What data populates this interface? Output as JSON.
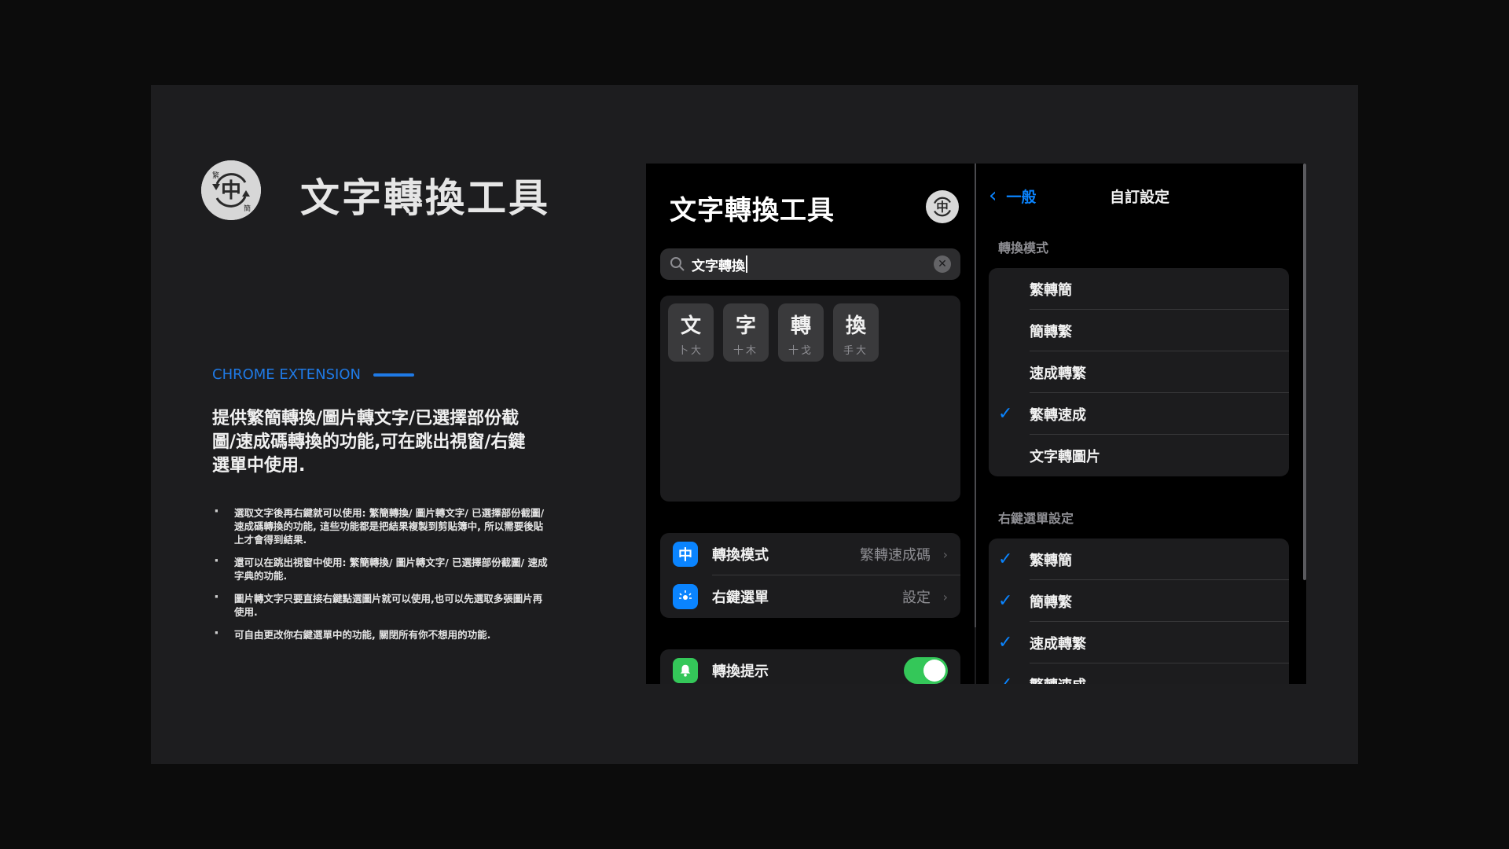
{
  "hero": {
    "title": "文字轉換工具",
    "logo_text": {
      "center": "中",
      "top": "繁",
      "bottom": "簡"
    },
    "eyebrow": "CHROME EXTENSION",
    "lead": "提供繁簡轉換/圖片轉文字/已選擇部份截圖/速成碼轉換的功能,可在跳出視窗/右鍵選單中使用.",
    "bullets": [
      "選取文字後再右鍵就可以使用: 繁簡轉換/ 圖片轉文字/ 已選擇部份截圖/ 速成碼轉換的功能, 這些功能都是把結果複製到剪貼簿中, 所以需要後貼上才會得到結果.",
      "還可以在跳出視窗中使用: 繁簡轉換/ 圖片轉文字/ 已選擇部份截圖/ 速成字典的功能.",
      "圖片轉文字只要直接右鍵點選圖片就可以使用,也可以先選取多張圖片再使用.",
      "可自由更改你右鍵選單中的功能, 關閉所有你不想用的功能."
    ]
  },
  "app": {
    "title": "文字轉換工具",
    "search": {
      "query": "文字轉換",
      "clear_icon": "xmark-circle-icon"
    },
    "chars": [
      {
        "char": "文",
        "code": "卜大"
      },
      {
        "char": "字",
        "code": "十木"
      },
      {
        "char": "轉",
        "code": "十戈"
      },
      {
        "char": "換",
        "code": "手大"
      }
    ],
    "settings": [
      {
        "icon_text": "中",
        "icon_color": "#0a84ff",
        "label": "轉換模式",
        "value": "繁轉速成碼"
      },
      {
        "icon": "tap-sparkle-icon",
        "icon_color": "#0a84ff",
        "label": "右鍵選單",
        "value": "設定"
      }
    ],
    "notify": {
      "icon": "bell-icon",
      "icon_color": "#34c759",
      "label": "轉換提示",
      "enabled": true
    }
  },
  "settings_screen": {
    "back_label": "一般",
    "title": "自訂設定",
    "mode_header": "轉換模式",
    "modes": [
      {
        "label": "繁轉簡",
        "checked": false
      },
      {
        "label": "簡轉繁",
        "checked": false
      },
      {
        "label": "速成轉繁",
        "checked": false
      },
      {
        "label": "繁轉速成",
        "checked": true
      },
      {
        "label": "文字轉圖片",
        "checked": false
      }
    ],
    "menu_header": "右鍵選單設定",
    "menu": [
      {
        "label": "繁轉簡",
        "checked": true
      },
      {
        "label": "簡轉繁",
        "checked": true
      },
      {
        "label": "速成轉繁",
        "checked": true
      },
      {
        "label": "繁轉速成",
        "checked": true
      }
    ]
  },
  "colors": {
    "accent": "#1f7ae6",
    "ios_blue": "#0a84ff",
    "ios_green": "#34c759",
    "card": "#1d1d1f"
  }
}
